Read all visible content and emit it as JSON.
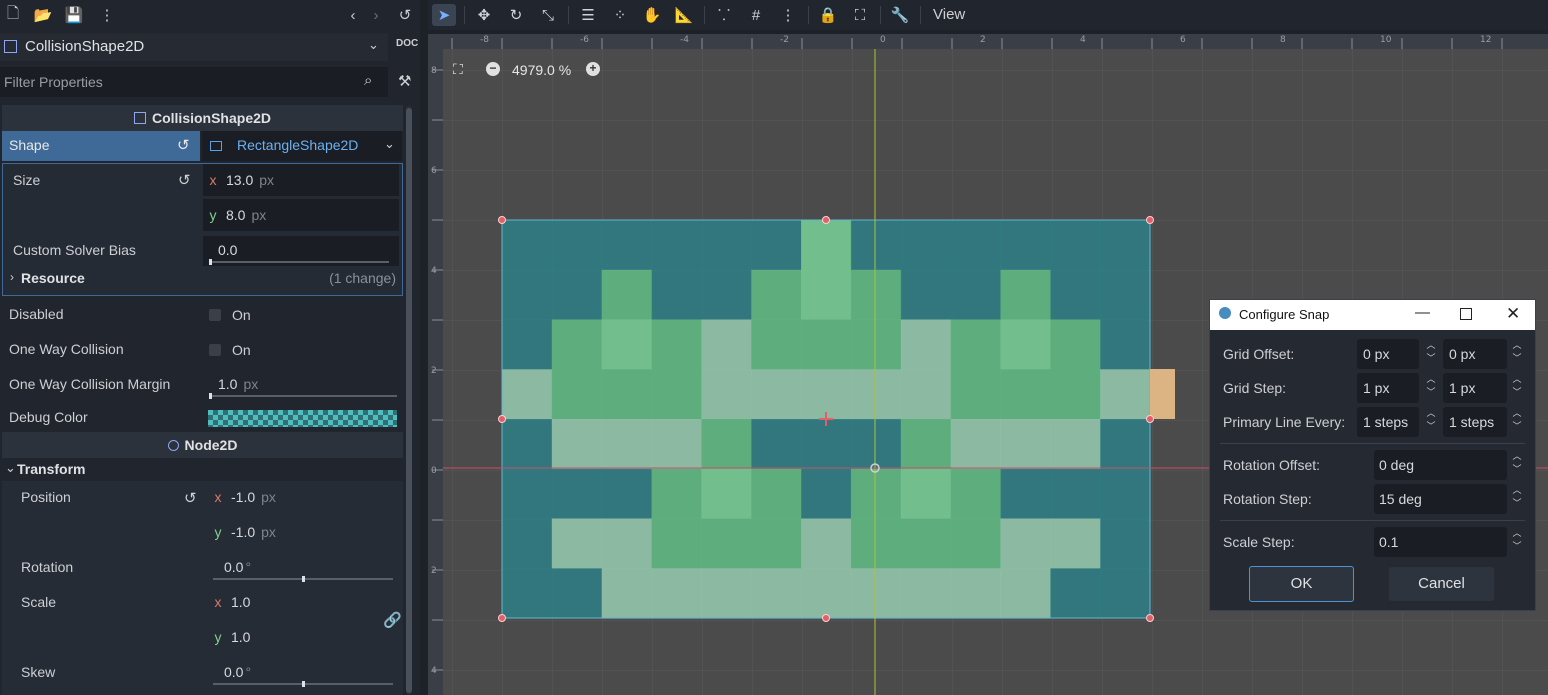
{
  "inspector": {
    "node_name": "CollisionShape2D",
    "filter_placeholder": "Filter Properties",
    "sections": {
      "collision_shape_header": "CollisionShape2D",
      "node2d_header": "Node2D",
      "transform_label": "Transform",
      "resource_label": "Resource",
      "resource_changes": "(1 change)"
    },
    "shape": {
      "label": "Shape",
      "value": "RectangleShape2D"
    },
    "size": {
      "label": "Size",
      "x": "13.0",
      "y": "8.0",
      "unit": "px"
    },
    "solver_bias": {
      "label": "Custom Solver Bias",
      "value": "0.0"
    },
    "disabled": {
      "label": "Disabled",
      "value": "On"
    },
    "one_way": {
      "label": "One Way Collision",
      "value": "On"
    },
    "one_way_margin": {
      "label": "One Way Collision Margin",
      "value": "1.0",
      "unit": "px"
    },
    "debug_color": {
      "label": "Debug Color"
    },
    "position": {
      "label": "Position",
      "x": "-1.0",
      "y": "-1.0",
      "unit": "px"
    },
    "rotation": {
      "label": "Rotation",
      "value": "0.0",
      "unit": "°"
    },
    "scale": {
      "label": "Scale",
      "x": "1.0",
      "y": "1.0"
    },
    "skew": {
      "label": "Skew",
      "value": "0.0",
      "unit": "°"
    },
    "axis_x": "x",
    "axis_y": "y"
  },
  "viewport": {
    "toolbar_view_menu": "View",
    "zoom_level": "4979.0 %",
    "ruler_top": [
      "-8",
      "-6",
      "-4",
      "-2",
      "0",
      "2",
      "4",
      "6",
      "8",
      "10",
      "12"
    ],
    "ruler_left": [
      "8",
      "6",
      "4",
      "2",
      "0",
      "2",
      "4"
    ]
  },
  "snap_dialog": {
    "title": "Configure Snap",
    "grid_offset": {
      "label": "Grid Offset:",
      "x": "0 px",
      "y": "0 px"
    },
    "grid_step": {
      "label": "Grid Step:",
      "x": "1 px",
      "y": "1 px"
    },
    "primary_line": {
      "label": "Primary Line Every:",
      "x": "1 steps",
      "y": "1 steps"
    },
    "rotation_offset": {
      "label": "Rotation Offset:",
      "value": "0 deg"
    },
    "rotation_step": {
      "label": "Rotation Step:",
      "value": "15 deg"
    },
    "scale_step": {
      "label": "Scale Step:",
      "value": "0.1"
    },
    "ok_label": "OK",
    "cancel_label": "Cancel"
  },
  "colors": {
    "accent": "#4d93d4",
    "shape_fill": "#2e7f86",
    "handle": "#e0606a",
    "sprite_light": "#8fbfa6",
    "sprite_mid": "#5fb27f",
    "sprite_bright": "#74c48f"
  }
}
